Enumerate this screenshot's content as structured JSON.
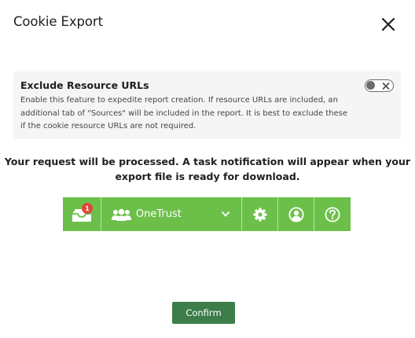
{
  "modal": {
    "title": "Cookie Export",
    "close_icon": "close-icon"
  },
  "exclude_section": {
    "title": "Exclude Resource URLs",
    "description": "Enable this feature to expedite report creation. If resource URLs are included, an additional tab of \"Sources\" will be included in the report. It is best to exclude these if the cookie resource URLs are not required.",
    "toggle_on": false
  },
  "message": "Your request will be processed. A task notification will appear when your export file is ready for download.",
  "notification_bar": {
    "background_color": "#6cc04a",
    "inbox_badge": "1",
    "org_name": "OneTrust",
    "icons": [
      "inbox-icon",
      "users-icon",
      "chevron-down-icon",
      "gear-icon",
      "user-circle-icon",
      "help-icon"
    ]
  },
  "confirm_label": "Confirm",
  "colors": {
    "confirm_button": "#3c7d4a",
    "badge": "#e0453c",
    "panel_background": "#f5f5f5"
  }
}
